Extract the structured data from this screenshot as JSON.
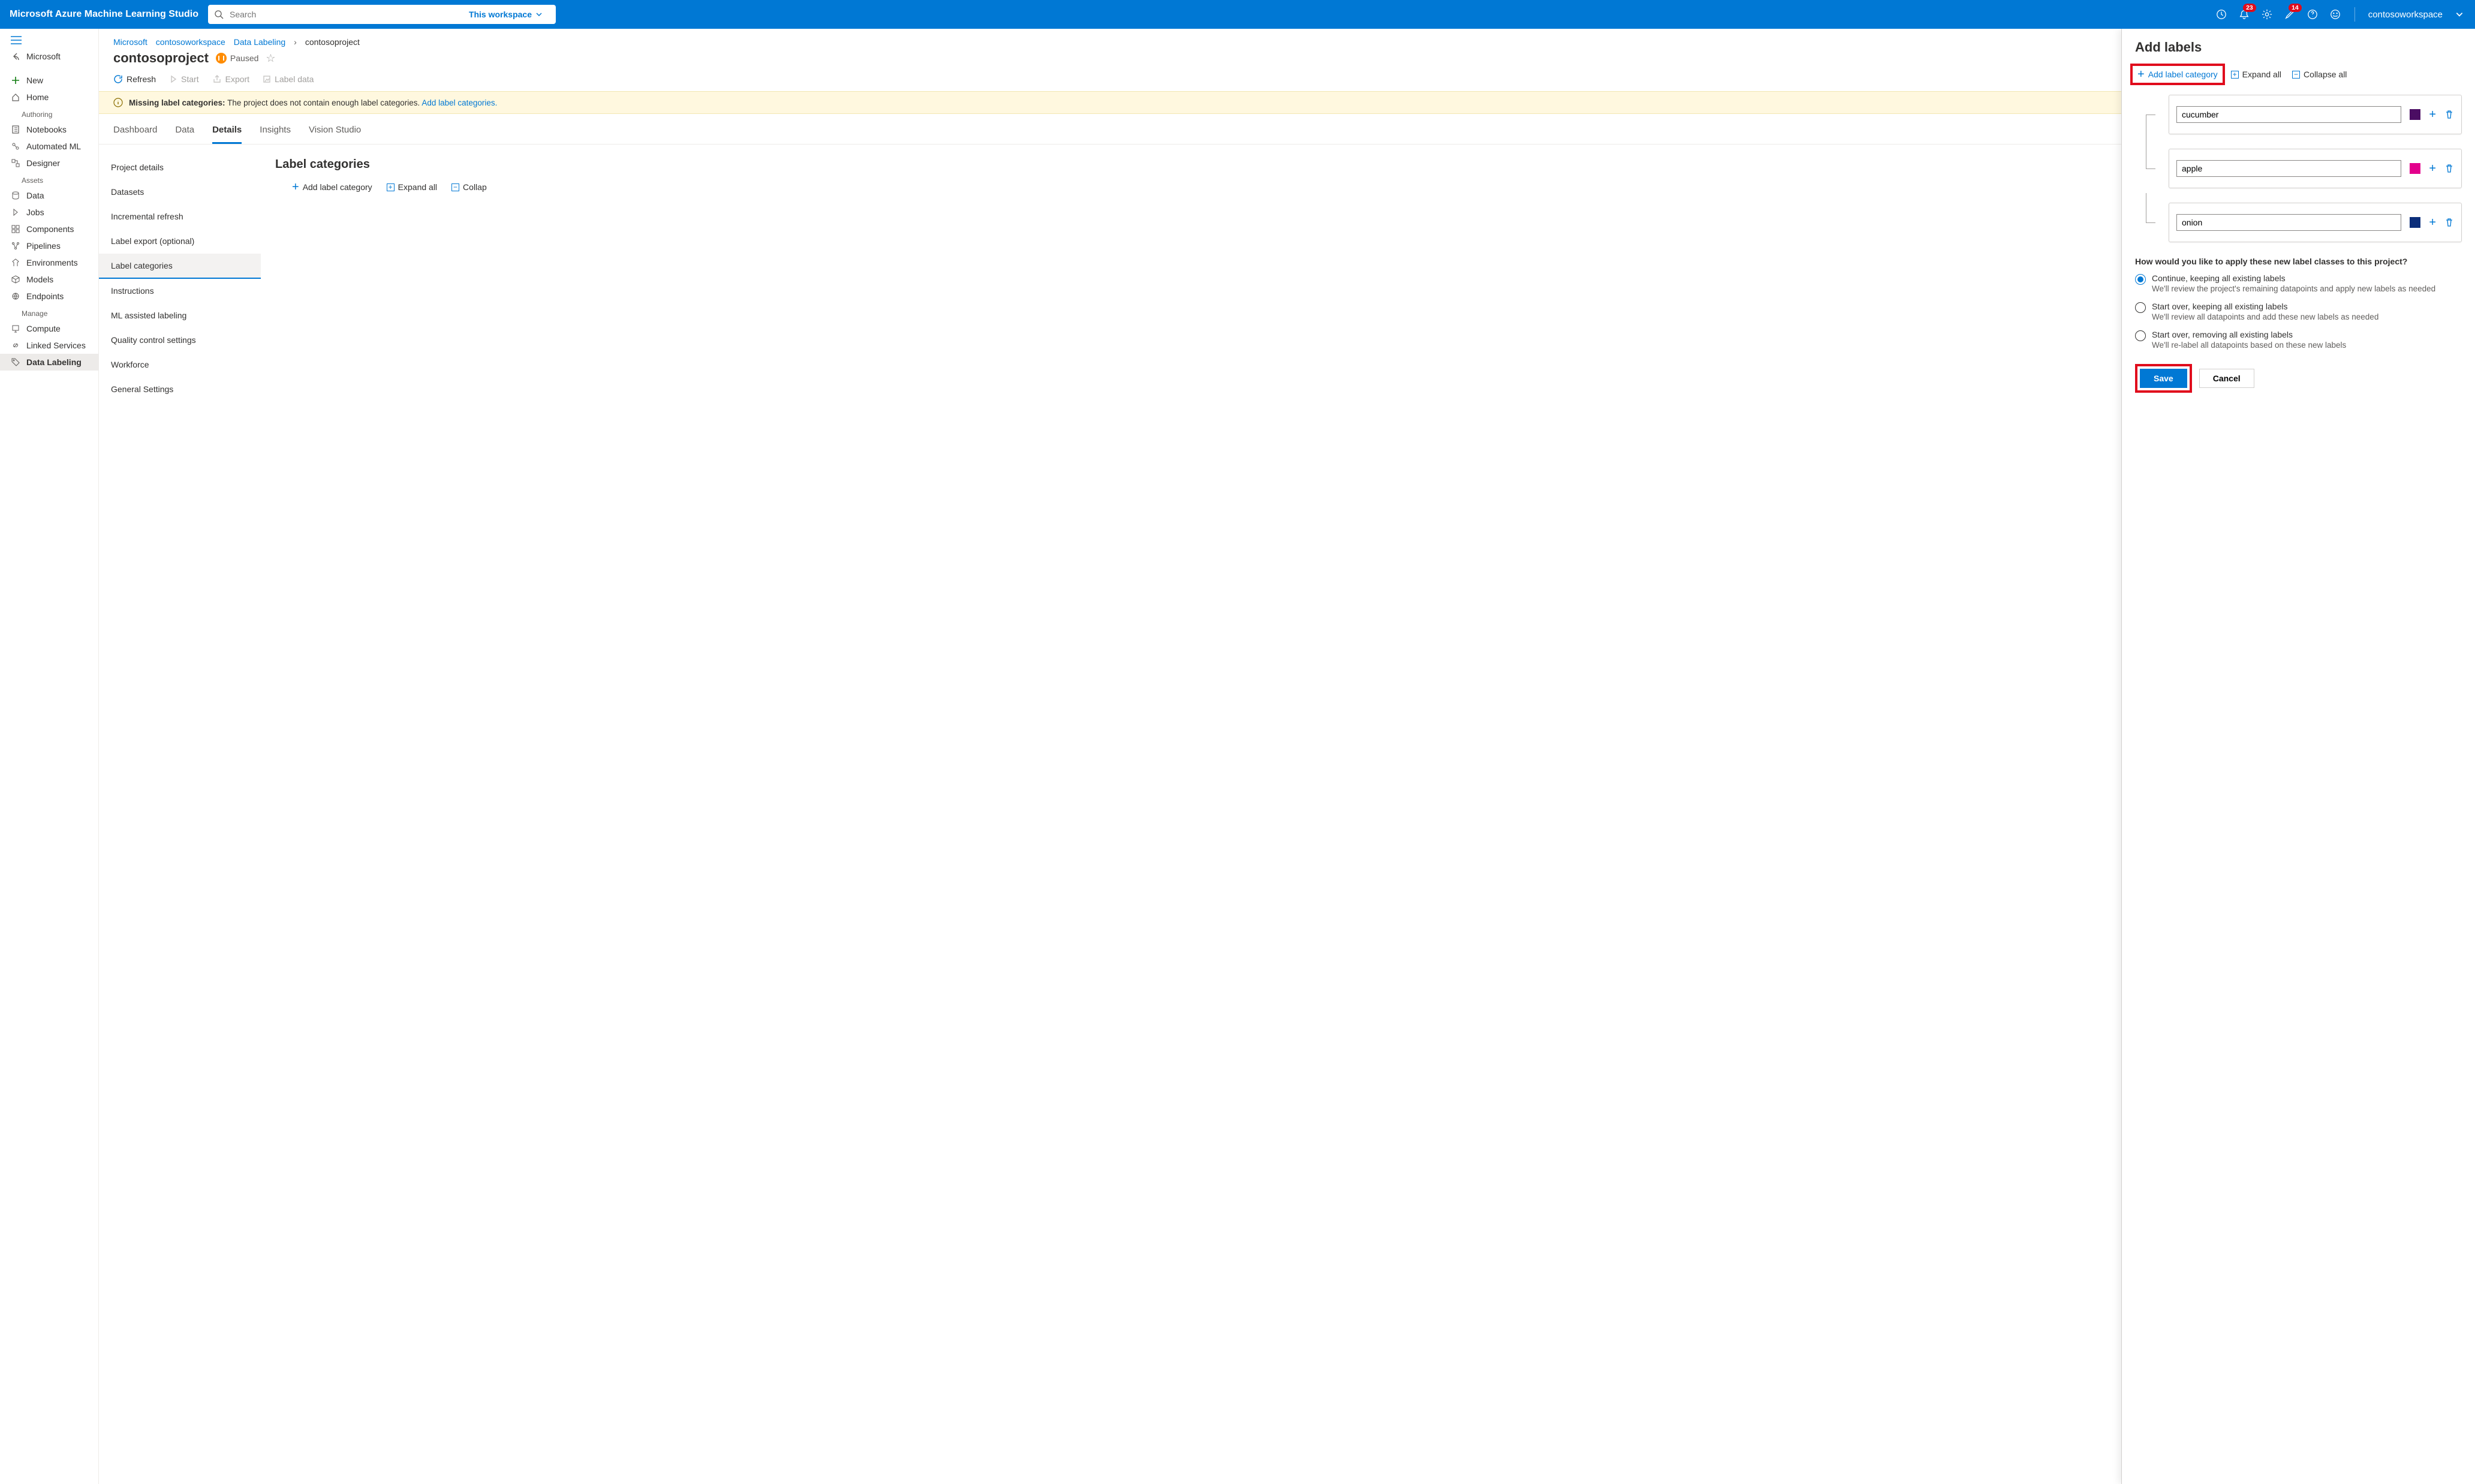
{
  "topbar": {
    "brand": "Microsoft Azure Machine Learning Studio",
    "search_placeholder": "Search",
    "scope_label": "This workspace",
    "workspace": "contosoworkspace",
    "notification_count": "23",
    "feedback_count": "14"
  },
  "sidebar": {
    "back_label": "Microsoft",
    "new_label": "New",
    "home_label": "Home",
    "sections": {
      "authoring": "Authoring",
      "assets": "Assets",
      "manage": "Manage"
    },
    "items": {
      "notebooks": "Notebooks",
      "automl": "Automated ML",
      "designer": "Designer",
      "data": "Data",
      "jobs": "Jobs",
      "components": "Components",
      "pipelines": "Pipelines",
      "environments": "Environments",
      "models": "Models",
      "endpoints": "Endpoints",
      "compute": "Compute",
      "linked": "Linked Services",
      "labeling": "Data Labeling"
    }
  },
  "breadcrumb": {
    "items": [
      "Microsoft",
      "contosoworkspace",
      "Data Labeling",
      "contosoproject"
    ]
  },
  "page": {
    "title": "contosoproject",
    "status": "Paused"
  },
  "commands": {
    "refresh": "Refresh",
    "start": "Start",
    "export": "Export",
    "label_data": "Label data"
  },
  "banner": {
    "title": "Missing label categories:",
    "text": "The project does not contain enough label categories.",
    "link": "Add label categories."
  },
  "tabs": {
    "dashboard": "Dashboard",
    "data": "Data",
    "details": "Details",
    "insights": "Insights",
    "vision": "Vision Studio"
  },
  "side_tabs": {
    "project_details": "Project details",
    "datasets": "Datasets",
    "incremental": "Incremental refresh",
    "export": "Label export (optional)",
    "categories": "Label categories",
    "instructions": "Instructions",
    "ml_assist": "ML assisted labeling",
    "quality": "Quality control settings",
    "workforce": "Workforce",
    "general": "General Settings"
  },
  "label_categories_section": {
    "heading": "Label categories",
    "add": "Add label category",
    "expand": "Expand all",
    "collapse": "Collap"
  },
  "panel": {
    "title": "Add labels",
    "add": "Add label category",
    "expand": "Expand all",
    "collapse": "Collapse all",
    "labels": [
      {
        "name": "cucumber",
        "color": "#4b0d63"
      },
      {
        "name": "apple",
        "color": "#e3008c"
      },
      {
        "name": "onion",
        "color": "#0b2e7a"
      }
    ],
    "question": "How would you like to apply these new label classes to this project?",
    "options": [
      {
        "title": "Continue, keeping all existing labels",
        "desc": "We'll review the project's remaining datapoints and apply new labels as needed",
        "selected": true
      },
      {
        "title": "Start over, keeping all existing labels",
        "desc": "We'll review all datapoints and add these new labels as needed",
        "selected": false
      },
      {
        "title": "Start over, removing all existing labels",
        "desc": "We'll re-label all datapoints based on these new labels",
        "selected": false
      }
    ],
    "save": "Save",
    "cancel": "Cancel"
  }
}
